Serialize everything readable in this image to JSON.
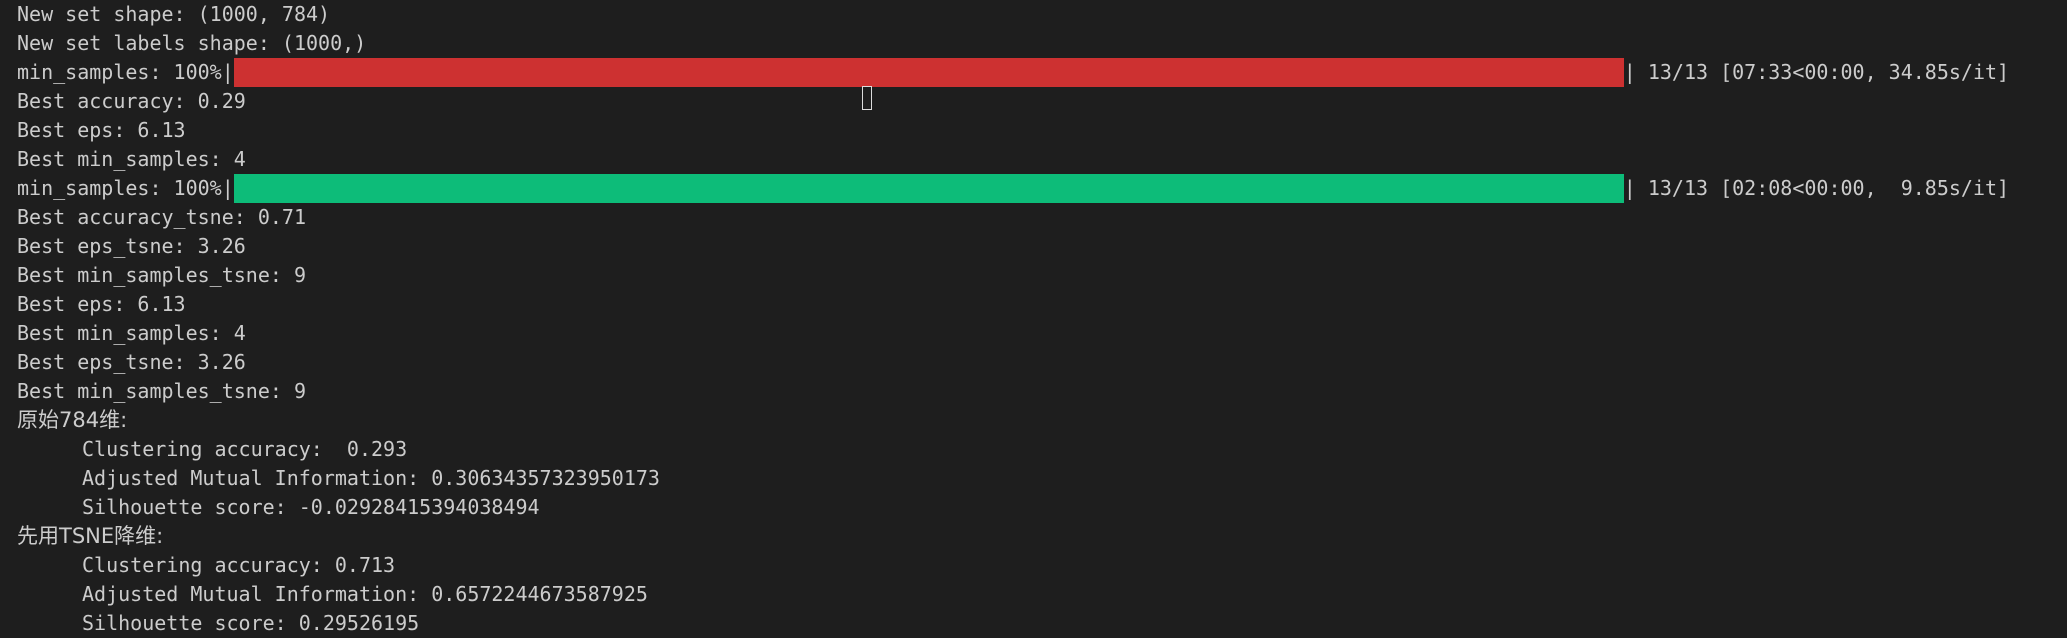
{
  "lines": {
    "l0": "New set shape: (1000, 784)",
    "l1": "New set labels shape: (1000,)",
    "l3": "Best accuracy: 0.29",
    "l4": "Best eps: 6.13",
    "l5": "Best min_samples: 4",
    "l7": "Best accuracy_tsne: 0.71",
    "l8": "Best eps_tsne: 3.26",
    "l9": "Best min_samples_tsne: 9",
    "l10": "Best eps: 6.13",
    "l11": "Best min_samples: 4",
    "l12": "Best eps_tsne: 3.26",
    "l13": "Best min_samples_tsne: 9",
    "l14": "原始784维:",
    "l15": "Clustering accuracy:  0.293",
    "l16": "Adjusted Mutual Information: 0.30634357323950173",
    "l17": "Silhouette score: -0.02928415394038494",
    "l18": "先用TSNE降维:",
    "l19": "Clustering accuracy: 0.713",
    "l20": "Adjusted Mutual Information: 0.6572244673587925",
    "l21": "Silhouette score: 0.29526195"
  },
  "progress": [
    {
      "prefix": "min_samples: 100%|",
      "suffix": "| 13/13 [07:33<00:00, 34.85s/it]",
      "fraction": 1.0,
      "color": "#cd3131"
    },
    {
      "prefix": "min_samples: 100%|",
      "suffix": "| 13/13 [02:08<00:00,  9.85s/it]",
      "fraction": 1.0,
      "color": "#0dbc79"
    }
  ]
}
